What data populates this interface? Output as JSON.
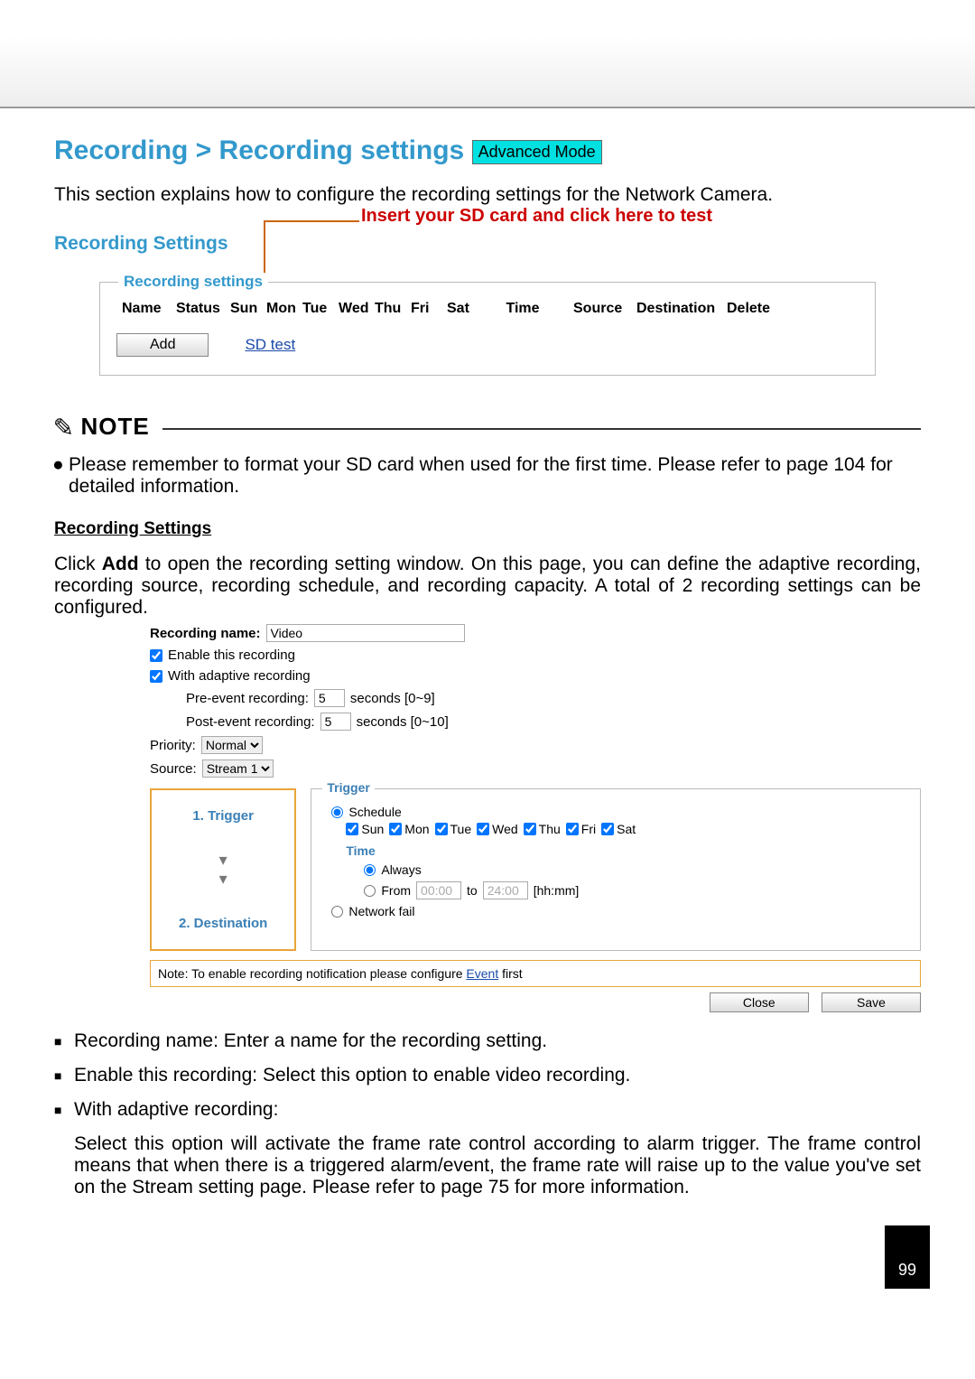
{
  "page_title": "Recording > Recording settings",
  "mode_tag": "Advanced Mode",
  "intro_text": "This section explains how to configure the recording settings for the Network Camera.",
  "section_heading": "Recording Settings",
  "sd_callout": "Insert your SD card and click here to test",
  "fieldset_legend": "Recording settings",
  "columns": {
    "name": "Name",
    "status": "Status",
    "sun": "Sun",
    "mon": "Mon",
    "tue": "Tue",
    "wed": "Wed",
    "thu": "Thu",
    "fri": "Fri",
    "sat": "Sat",
    "time": "Time",
    "source": "Source",
    "dest": "Destination",
    "delete": "Delete"
  },
  "add_btn": "Add",
  "sd_test_link": "SD test",
  "note_word": "NOTE",
  "note_body": "Please remember to format your SD card when used for the first time. Please refer to page 104 for detailed information.",
  "rs_heading": "Recording Settings",
  "rs_para_prefix": "Click ",
  "rs_para_add": "Add",
  "rs_para_rest": " to open the recording setting window. On this page, you can define the adaptive recording, recording source, recording schedule, and recording capacity. A total of 2 recording settings can be configured.",
  "form": {
    "recording_name_label": "Recording name:",
    "recording_name_value": "Video",
    "enable_label": "Enable this recording",
    "adaptive_label": "With adaptive recording",
    "pre_label": "Pre-event recording:",
    "pre_value": "5",
    "pre_hint": "seconds [0~9]",
    "post_label": "Post-event recording:",
    "post_value": "5",
    "post_hint": "seconds [0~10]",
    "priority_label": "Priority:",
    "priority_value": "Normal",
    "source_label": "Source:",
    "source_value": "Stream 1",
    "step1": "1.  Trigger",
    "step2": "2.  Destination",
    "trigger_legend": "Trigger",
    "schedule_label": "Schedule",
    "days": {
      "sun": "Sun",
      "mon": "Mon",
      "tue": "Tue",
      "wed": "Wed",
      "thu": "Thu",
      "fri": "Fri",
      "sat": "Sat"
    },
    "time_label": "Time",
    "always_label": "Always",
    "from_label": "From",
    "from_value": "00:00",
    "to_label": "to",
    "to_value": "24:00",
    "hhmm": "[hh:mm]",
    "network_fail": "Network fail",
    "note_prefix": "Note: To enable recording notification please configure ",
    "note_link": "Event",
    "note_suffix": " first",
    "close_btn": "Close",
    "save_btn": "Save"
  },
  "bullets": {
    "b1": "Recording name: Enter a name for the recording setting.",
    "b2": "Enable this recording: Select this option to enable video recording.",
    "b3_head": "With adaptive recording:",
    "b3_body": "Select this option will activate the frame rate control according to alarm trigger. The frame control means that when there is a triggered alarm/event, the frame rate will raise up to the value you've set on the Stream setting page. Please refer to page 75 for more information."
  },
  "page_number": "99"
}
